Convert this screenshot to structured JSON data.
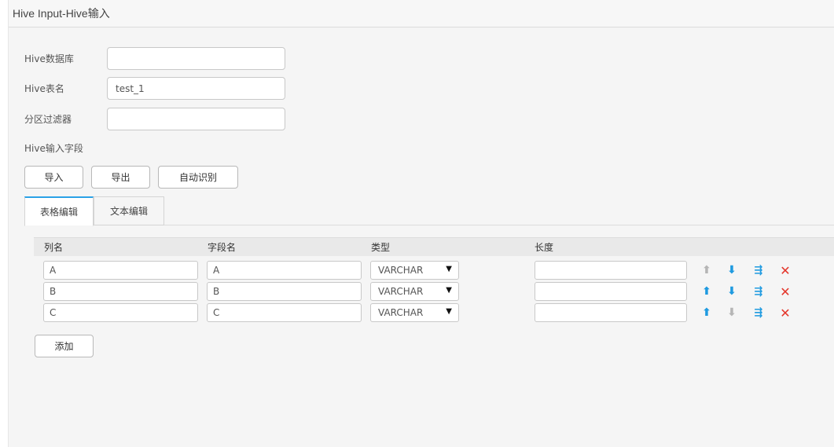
{
  "window": {
    "title": "Hive Input-Hive输入"
  },
  "form": {
    "database": {
      "label": "Hive数据库",
      "value": ""
    },
    "table": {
      "label": "Hive表名",
      "value": "test_1"
    },
    "partition_filter": {
      "label": "分区过滤器",
      "value": ""
    },
    "fields_label": "Hive输入字段"
  },
  "toolbar": {
    "import_label": "导入",
    "export_label": "导出",
    "auto_detect_label": "自动识别"
  },
  "tabs": [
    {
      "label": "表格编辑",
      "active": true
    },
    {
      "label": "文本编辑",
      "active": false
    }
  ],
  "grid": {
    "columns": [
      "列名",
      "字段名",
      "类型",
      "长度"
    ],
    "rows": [
      {
        "column_name": "A",
        "field_name": "A",
        "type": "VARCHAR",
        "length": ""
      },
      {
        "column_name": "B",
        "field_name": "B",
        "type": "VARCHAR",
        "length": ""
      },
      {
        "column_name": "C",
        "field_name": "C",
        "type": "VARCHAR",
        "length": ""
      }
    ],
    "add_label": "添加"
  },
  "colors": {
    "accent": "#1e9ae0",
    "delete": "#e4352a",
    "disabled": "#b5b5b5",
    "tab_active_border": "#2aa1e6"
  },
  "icons": {
    "move_up": "arrow-up-icon",
    "move_down": "arrow-down-icon",
    "copy": "copy-row-icon",
    "delete": "delete-icon"
  }
}
